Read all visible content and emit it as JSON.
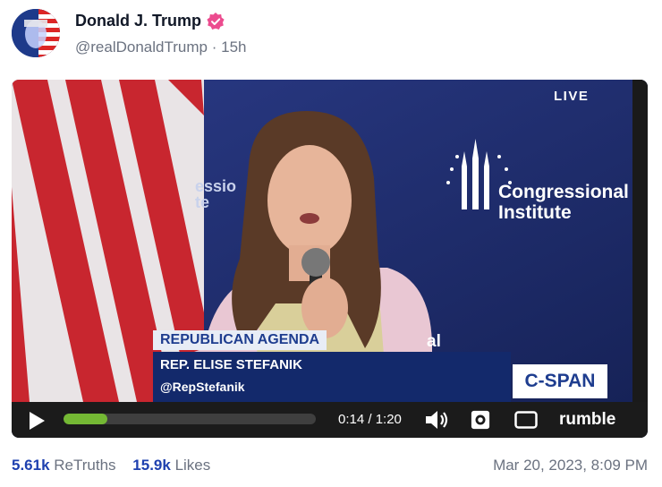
{
  "post": {
    "author_name": "Donald J. Trump",
    "handle": "@realDonaldTrump",
    "separator": "·",
    "time_ago": "15h"
  },
  "video": {
    "live_label": "LIVE",
    "backdrop_text_line1": "Congressional",
    "backdrop_text_line2": "Institute",
    "backdrop_partial_left_line1": "essio",
    "backdrop_partial_left_line2": "te",
    "backdrop_partial_right": "al",
    "chyron_title": "REPUBLICAN AGENDA",
    "chyron_name": "REP. ELISE STEFANIK",
    "chyron_handle": "@RepStefanik",
    "network_logo": "C-SPAN",
    "current_time": "0:14",
    "duration": "1:20",
    "time_display": "0:14 / 1:20",
    "progress_fraction": 0.175,
    "player_brand": "rumble"
  },
  "stats": {
    "retruths_count": "5.61k",
    "retruths_label": "ReTruths",
    "likes_count": "15.9k",
    "likes_label": "Likes",
    "timestamp": "Mar 20, 2023, 8:09 PM"
  },
  "icons": {
    "verified": "verified-badge-icon",
    "play": "play-icon",
    "volume": "volume-icon",
    "settings": "gear-icon",
    "fullscreen": "screen-icon"
  },
  "colors": {
    "verified_badge": "#ec4c8f",
    "stats_number": "#1e40af",
    "progress_fill": "#74b834",
    "video_backdrop": "#1c2a63",
    "chyron_blue": "#13296b"
  }
}
